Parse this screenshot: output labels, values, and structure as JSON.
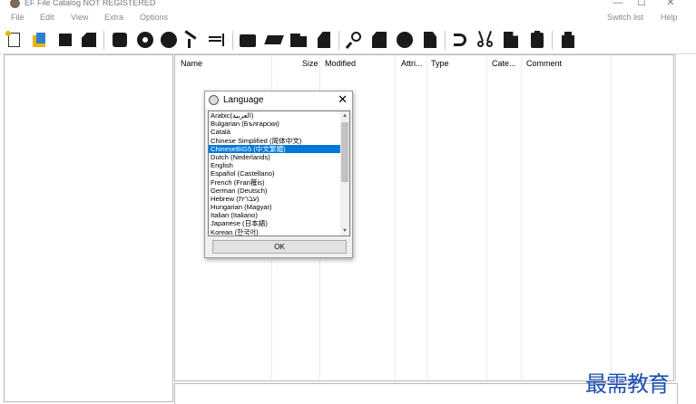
{
  "window": {
    "title": "EF File Catalog NOT REGISTERED",
    "minimize": "—",
    "maximize": "☐",
    "close": "✕"
  },
  "menu": {
    "left": [
      "File",
      "Edit",
      "View",
      "Extra",
      "Options"
    ],
    "right": [
      "Switch list",
      "Help"
    ]
  },
  "toolbar": {
    "buttons": [
      "new-catalog-icon",
      "open-catalog-icon",
      "square-icon",
      "document-icon",
      "rounded-square-icon",
      "disc-icon",
      "circle-icon",
      "tools-icon",
      "edit-field-icon",
      "folder-icon",
      "pen-icon",
      "folder-open-icon",
      "bookmark-icon",
      "search-icon",
      "page-icon",
      "circle-icon",
      "copy-icon",
      "undo-icon",
      "cut-icon",
      "paste-icon",
      "clipboard-icon",
      "delete-icon"
    ]
  },
  "list": {
    "columns": [
      "Name",
      "Size",
      "Modified",
      "Attri...",
      "Type",
      "Cate...",
      "Comment"
    ]
  },
  "dialog": {
    "title": "Language",
    "close": "✕",
    "ok_label": "OK",
    "languages": [
      "Arabic(العربية)",
      "Bulgarian (Български)",
      "Català",
      "Chinese Simplified (简体中文)",
      "ChineseBIG5 (中文繁體)",
      "Dutch (Nederlands)",
      "English",
      "Español (Castellano)",
      "French (Fran蓷is)",
      "German (Deutsch)",
      "Hebrew (עברית)",
      "Hungarian (Magyar)",
      "Italian (Italiano)",
      "Japanese (日本語)",
      "Korean (한국어)"
    ],
    "selected_index": 4,
    "scroll_up": "▲",
    "scroll_down": "▼"
  },
  "watermark": "最需教育"
}
